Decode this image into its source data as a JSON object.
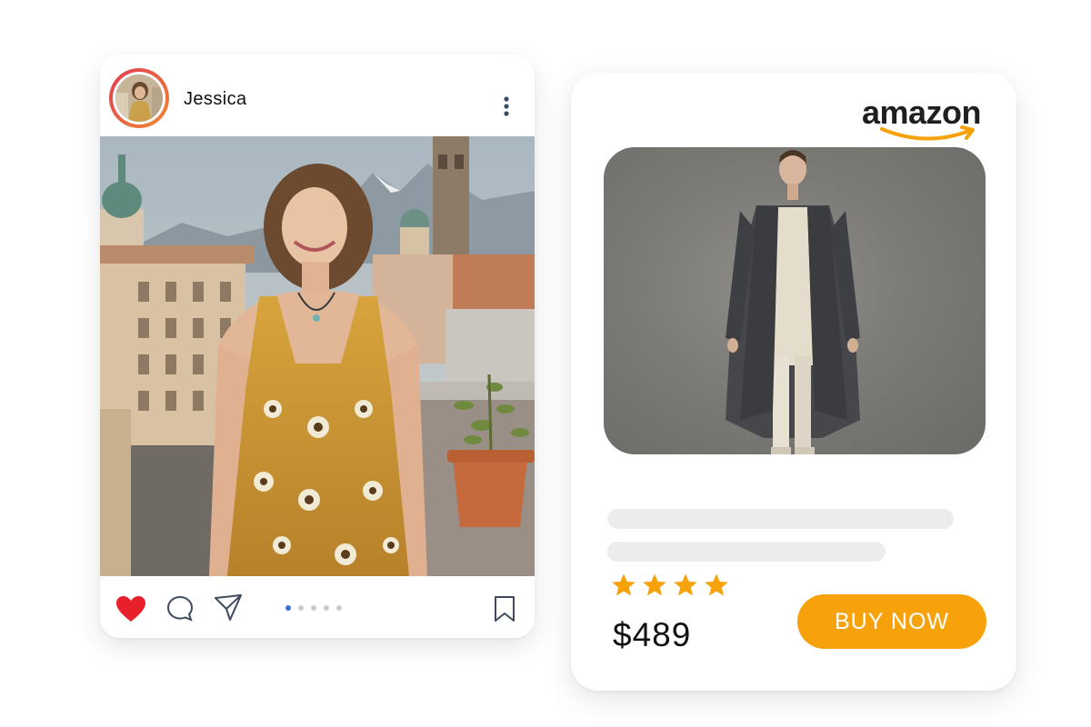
{
  "post": {
    "username": "Jessica",
    "carousel": {
      "total": 5,
      "active_index": 1
    },
    "icons": {
      "avatar": "profile-avatar",
      "more": "vertical-ellipsis-icon",
      "like": "heart-icon",
      "comment": "comment-bubble-icon",
      "share": "paper-plane-icon",
      "save": "bookmark-icon"
    },
    "colors": {
      "like": "#e8202c",
      "dot_active": "#3b6fd6",
      "dot_inactive": "#c8cbd2"
    }
  },
  "product": {
    "brand": "amazon",
    "rating_stars": 4,
    "price": "$489",
    "buy_button_label": "BUY NOW",
    "colors": {
      "accent": "#f7a20a",
      "star": "#f7a20a"
    },
    "icons": {
      "star": "star-icon",
      "brand_smile": "amazon-smile-arrow-icon"
    }
  }
}
